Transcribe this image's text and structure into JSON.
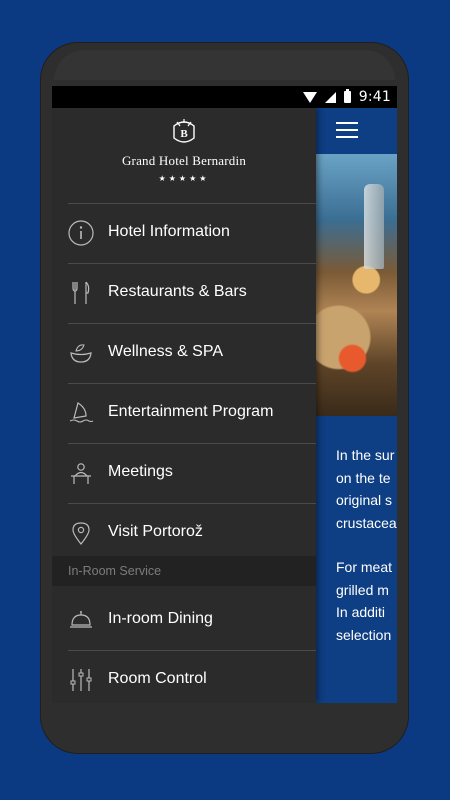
{
  "status_bar": {
    "time": "9:41"
  },
  "brand": {
    "name": "Grand Hotel Bernardin",
    "stars": "★★★★★"
  },
  "drawer": {
    "items": [
      {
        "label": "Hotel Information",
        "icon": "info-icon"
      },
      {
        "label": "Restaurants & Bars",
        "icon": "fork-knife-icon"
      },
      {
        "label": "Wellness  & SPA",
        "icon": "spa-bowl-icon"
      },
      {
        "label": "Entertainment Program",
        "icon": "sailboat-icon"
      },
      {
        "label": "Meetings",
        "icon": "meeting-icon"
      },
      {
        "label": "Visit Portorož",
        "icon": "location-pin-icon"
      }
    ],
    "section_title": "In-Room Service",
    "section_items": [
      {
        "label": "In-room Dining",
        "icon": "cloche-icon"
      },
      {
        "label": "Room Control",
        "icon": "sliders-icon"
      }
    ]
  },
  "content": {
    "lines": [
      "In the sur",
      "on the te",
      "original s",
      "crustacea"
    ],
    "lines2": [
      "For meat",
      "grilled m",
      "In additi",
      "selection"
    ]
  },
  "colors": {
    "background": "#0b3a82",
    "drawer": "#2b2b2b",
    "content": "#0e3e83"
  }
}
